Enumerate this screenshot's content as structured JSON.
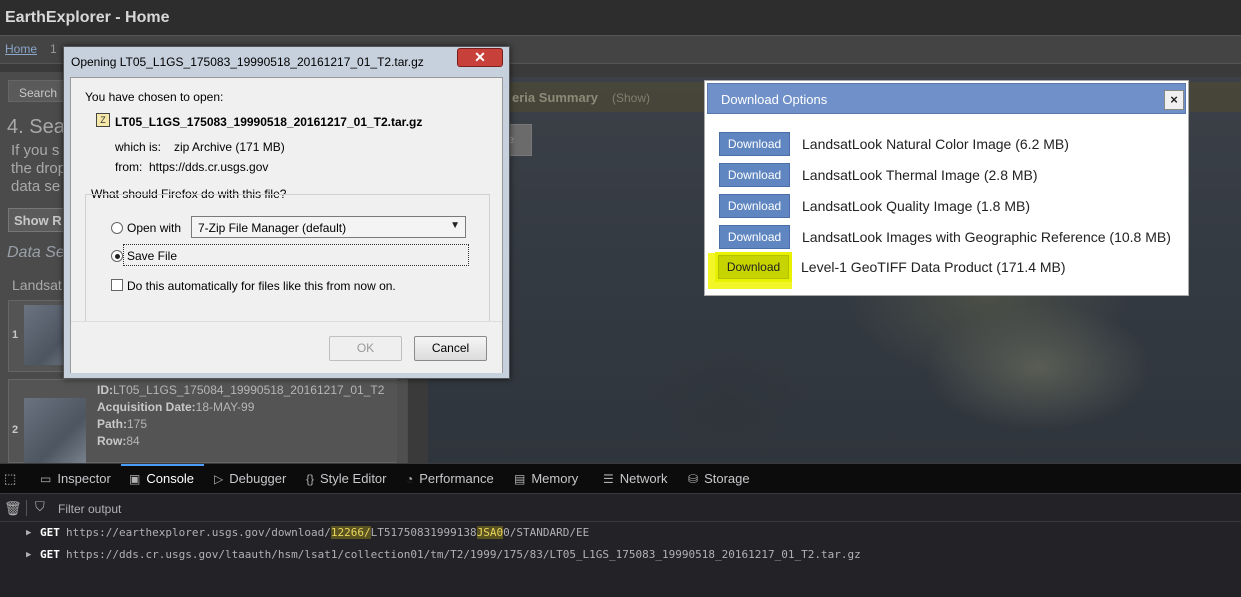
{
  "window": {
    "title": "EarthExplorer - Home"
  },
  "breadcrumb": {
    "home": "Home",
    "next": "1"
  },
  "left_panel": {
    "tab_label": "Search",
    "step_title": "4. Sea",
    "intro_text": "If you s the drop data se",
    "show_button": "Show R",
    "datasets_heading": "Data Se",
    "dataset_name": "Landsat",
    "results": [
      {
        "index": "1"
      },
      {
        "index": "2",
        "id": "LT05_L1GS_175084_19990518_20161217_01_T2",
        "acq_label": "Acquisition Date:",
        "acq_value": "18-MAY-99",
        "path_label": "Path:",
        "path_value": "175",
        "row_label": "Row:",
        "row_value": "84"
      }
    ]
  },
  "map_header": {
    "title": "eria Summary",
    "show": "(Show)",
    "map_button": "te"
  },
  "download_options": {
    "title": "Download Options",
    "close": "×",
    "button_label": "Download",
    "items": [
      "LandsatLook Natural Color Image (6.2 MB)",
      "LandsatLook Thermal Image (2.8 MB)",
      "LandsatLook Quality Image (1.8 MB)",
      "LandsatLook Images with Geographic Reference (10.8 MB)",
      "Level-1 GeoTIFF Data Product (171.4 MB)"
    ],
    "highlight_color": "#f0f400"
  },
  "firefox_dialog": {
    "title": "Opening LT05_L1GS_175083_19990518_20161217_01_T2.tar.gz",
    "close": "✕",
    "chosen": "You have chosen to open:",
    "filename": "LT05_L1GS_175083_19990518_20161217_01_T2.tar.gz",
    "which_label": "which is:",
    "which_value": "zip Archive (171 MB)",
    "from_label": "from:",
    "from_value": "https://dds.cr.usgs.gov",
    "question": "What should Firefox do with this file?",
    "open_with_label": "Open with",
    "open_with_value": "7-Zip File Manager (default)",
    "save_file_label": "Save File",
    "auto_label": "Do this automatically for files like this from now on.",
    "ok": "OK",
    "cancel": "Cancel"
  },
  "devtools": {
    "tabs": [
      "Inspector",
      "Console",
      "Debugger",
      "Style Editor",
      "Performance",
      "Memory",
      "Network",
      "Storage"
    ],
    "selected_tab": "Console",
    "filter_placeholder": "Filter output",
    "logs": [
      {
        "method": "GET",
        "url_pre": "https://earthexplorer.usgs.gov/download/",
        "hl1": "12266/",
        "url_mid": "LT51750831999138",
        "hl2": "JSA0",
        "url_post": "0/STANDARD/EE"
      },
      {
        "method": "GET",
        "url": "https://dds.cr.usgs.gov/ltaauth/hsm/lsat1/collection01/tm/T2/1999/175/83/LT05_L1GS_175083_19990518_20161217_01_T2.tar.gz"
      }
    ]
  }
}
